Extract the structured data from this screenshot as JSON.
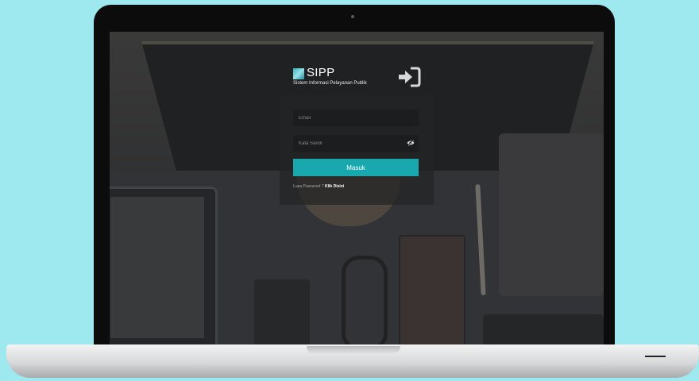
{
  "brand": {
    "name": "SIPP",
    "subtitle": "Sistem Informasi Pelayanan Publik"
  },
  "form": {
    "email_placeholder": "Email",
    "password_placeholder": "Kata Sandi",
    "submit_label": "Masuk",
    "forgot_text": "Lupa Password ?",
    "forgot_link": "Klik Disini"
  },
  "icons": {
    "logo": "sipp-logo-icon",
    "signin": "sign-in-icon",
    "toggle_password": "eye-slash-icon"
  },
  "colors": {
    "accent": "#19a8ad",
    "background": "#9ee9ef"
  }
}
